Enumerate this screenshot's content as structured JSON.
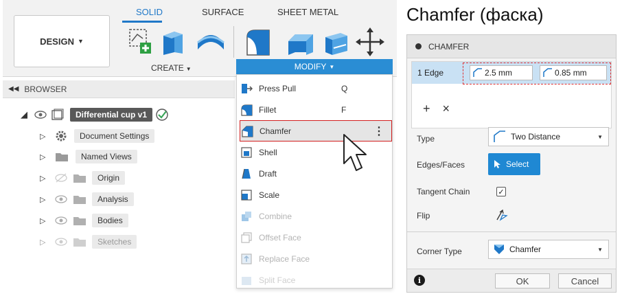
{
  "toolbar": {
    "tabs": [
      "SOLID",
      "SURFACE",
      "SHEET METAL"
    ],
    "active_tab": "SOLID",
    "design_label": "DESIGN",
    "create_label": "CREATE",
    "modify_label": "MODIFY"
  },
  "browser": {
    "title": "BROWSER",
    "root": "Differential cup v1",
    "items": [
      {
        "label": "Document Settings"
      },
      {
        "label": "Named Views"
      },
      {
        "label": "Origin"
      },
      {
        "label": "Analysis"
      },
      {
        "label": "Bodies"
      },
      {
        "label": "Sketches"
      }
    ]
  },
  "menu": {
    "items": [
      {
        "label": "Press Pull",
        "key": "Q",
        "icon": "press-pull-icon"
      },
      {
        "label": "Fillet",
        "key": "F",
        "icon": "fillet-icon"
      },
      {
        "label": "Chamfer",
        "key": "",
        "icon": "chamfer-icon"
      },
      {
        "label": "Shell",
        "key": "",
        "icon": "shell-icon"
      },
      {
        "label": "Draft",
        "key": "",
        "icon": "draft-icon"
      },
      {
        "label": "Scale",
        "key": "",
        "icon": "scale-icon"
      },
      {
        "label": "Combine",
        "key": "",
        "icon": "combine-icon"
      },
      {
        "label": "Offset Face",
        "key": "",
        "icon": "offset-face-icon"
      },
      {
        "label": "Replace Face",
        "key": "",
        "icon": "replace-face-icon"
      },
      {
        "label": "Split Face",
        "key": "",
        "icon": "split-face-icon"
      }
    ],
    "kebab": "⋮"
  },
  "right_title": "Chamfer (фаска)",
  "dialog": {
    "title": "CHAMFER",
    "edge_count": "1 Edge",
    "distance1": "2.5 mm",
    "distance2": "0.85 mm",
    "plus": "+",
    "times": "×",
    "type_label": "Type",
    "type_value": "Two Distance",
    "edges_label": "Edges/Faces",
    "select_label": "Select",
    "tangent_label": "Tangent Chain",
    "tangent_checked": "✓",
    "flip_label": "Flip",
    "corner_label": "Corner Type",
    "corner_value": "Chamfer",
    "ok_label": "OK",
    "cancel_label": "Cancel",
    "info": "i"
  }
}
